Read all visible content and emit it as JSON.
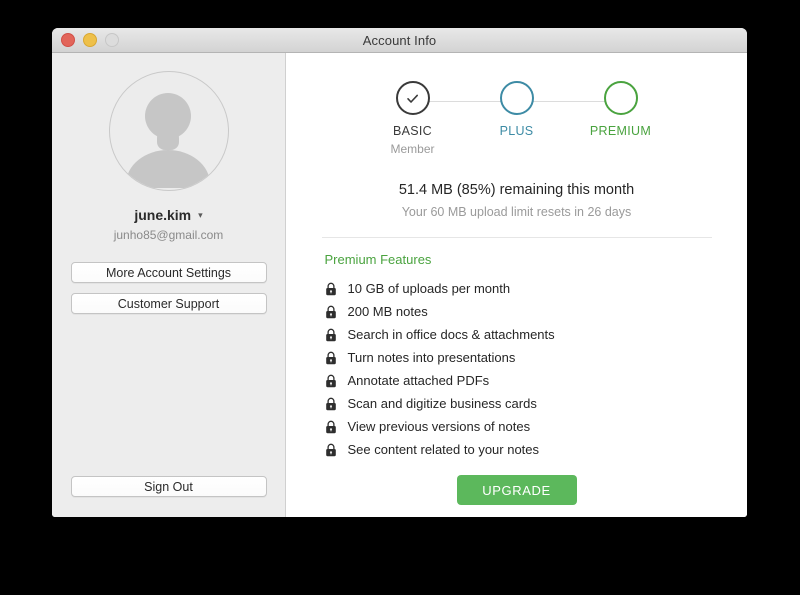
{
  "window": {
    "title": "Account Info",
    "controls": {
      "close": "close-button",
      "minimize": "minimize-button",
      "zoom": "zoom-button"
    }
  },
  "sidebar": {
    "avatar_icon": "default-user-avatar",
    "username": "june.kim",
    "username_chevron": "▾",
    "email": "junho85@gmail.com",
    "buttons": [
      {
        "label": "More Account Settings",
        "name": "more-account-settings"
      },
      {
        "label": "Customer Support",
        "name": "customer-support"
      }
    ],
    "sign_out_label": "Sign Out"
  },
  "membership": {
    "tiers": [
      {
        "label": "BASIC",
        "sublabel": "Member",
        "state": "current",
        "color": "#3a3a3a",
        "icon": "check-icon"
      },
      {
        "label": "PLUS",
        "sublabel": "",
        "state": "available",
        "color": "#3d8ba5",
        "icon": ""
      },
      {
        "label": "PREMIUM",
        "sublabel": "",
        "state": "available",
        "color": "#4aa33f",
        "icon": ""
      }
    ]
  },
  "quota": {
    "remaining_text": "51.4 MB (85%) remaining this month",
    "reset_text": "Your 60 MB upload limit resets in 26 days",
    "remaining_size": "51.4 MB",
    "remaining_percent": "85%",
    "limit_size": "60 MB",
    "reset_days": "26 days"
  },
  "features": {
    "heading": "Premium Features",
    "heading_color": "#4aa33f",
    "lock_icon": "lock-icon",
    "items": [
      "10 GB of uploads per month",
      "200 MB notes",
      "Search in office docs & attachments",
      "Turn notes into presentations",
      "Annotate attached PDFs",
      "Scan and digitize business cards",
      "View previous versions of notes",
      "See content related to your notes"
    ]
  },
  "upgrade": {
    "label": "UPGRADE",
    "color": "#5cb85c"
  }
}
